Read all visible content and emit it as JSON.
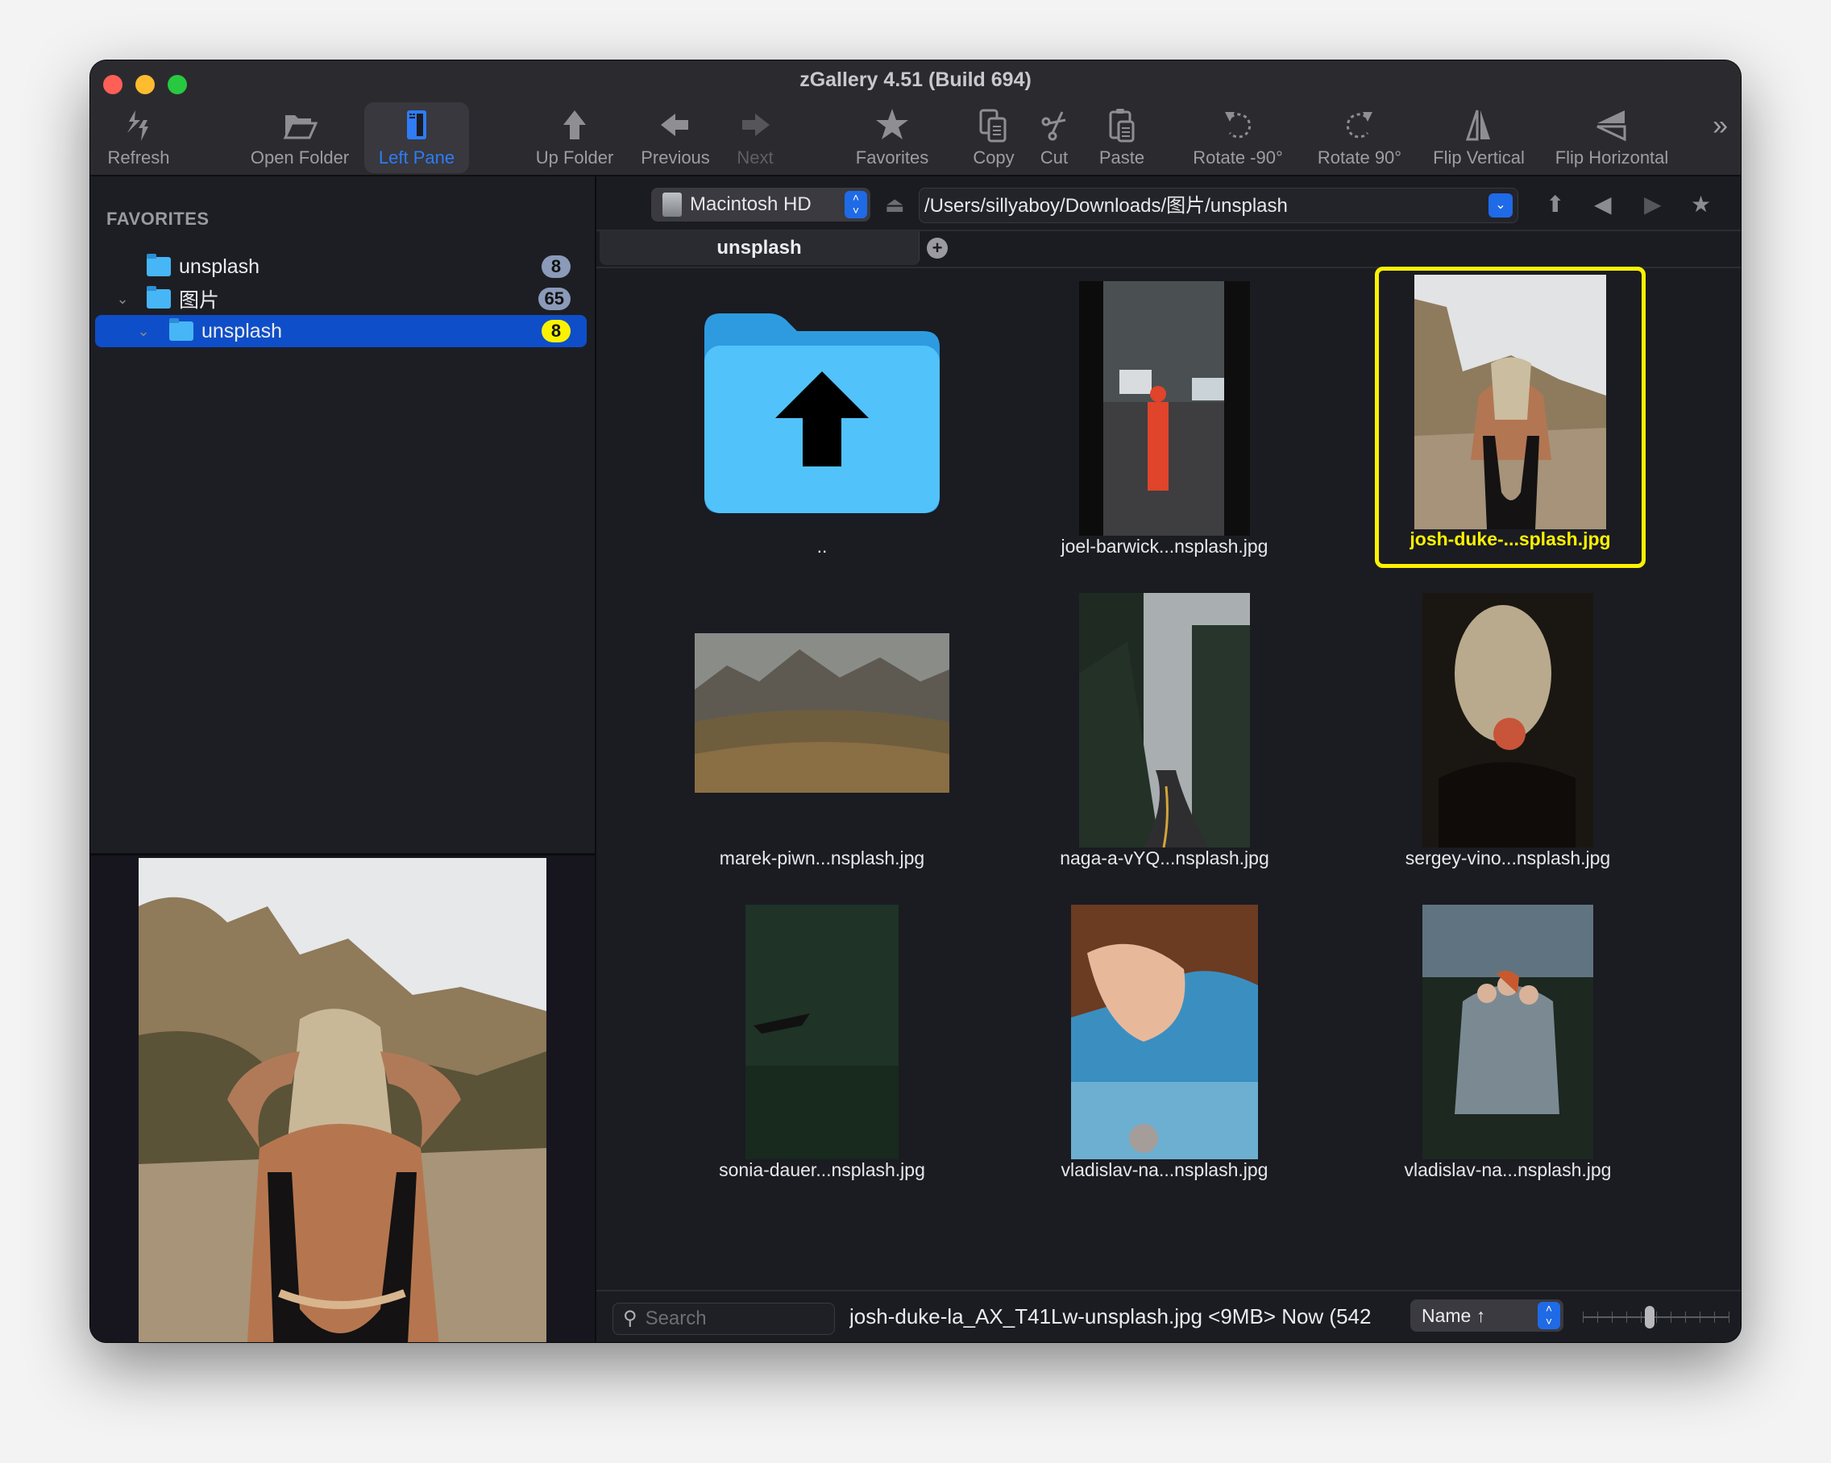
{
  "window": {
    "title": "zGallery 4.51 (Build 694)"
  },
  "toolbar": {
    "items": [
      {
        "id": "refresh",
        "label": "Refresh",
        "icon": "refresh-icon",
        "state": "normal"
      },
      {
        "id": "open-folder",
        "label": "Open Folder",
        "icon": "folder-open-icon",
        "state": "normal"
      },
      {
        "id": "left-pane",
        "label": "Left Pane",
        "icon": "sidebar-icon",
        "state": "active"
      },
      {
        "id": "up-folder",
        "label": "Up Folder",
        "icon": "arrow-up-icon",
        "state": "normal"
      },
      {
        "id": "previous",
        "label": "Previous",
        "icon": "arrow-left-icon",
        "state": "normal"
      },
      {
        "id": "next",
        "label": "Next",
        "icon": "arrow-right-icon",
        "state": "disabled"
      },
      {
        "id": "favorites",
        "label": "Favorites",
        "icon": "star-icon",
        "state": "normal"
      },
      {
        "id": "copy",
        "label": "Copy",
        "icon": "copy-icon",
        "state": "normal"
      },
      {
        "id": "cut",
        "label": "Cut",
        "icon": "scissors-icon",
        "state": "normal"
      },
      {
        "id": "paste",
        "label": "Paste",
        "icon": "paste-icon",
        "state": "normal"
      },
      {
        "id": "rotate-ccw",
        "label": "Rotate -90°",
        "icon": "rotate-ccw-icon",
        "state": "normal"
      },
      {
        "id": "rotate-cw",
        "label": "Rotate 90°",
        "icon": "rotate-cw-icon",
        "state": "normal"
      },
      {
        "id": "flip-vertical",
        "label": "Flip Vertical",
        "icon": "flip-vertical-icon",
        "state": "normal"
      },
      {
        "id": "flip-horizontal",
        "label": "Flip Horizontal",
        "icon": "flip-horizontal-icon",
        "state": "normal"
      }
    ],
    "overflow_glyph": "»"
  },
  "sidebar": {
    "heading": "FAVORITES",
    "items": [
      {
        "label": "unsplash",
        "count": "8",
        "level": 0,
        "expanded": null,
        "selected": false
      },
      {
        "label": "图片",
        "count": "65",
        "level": 0,
        "expanded": true,
        "selected": false
      },
      {
        "label": "unsplash",
        "count": "8",
        "level": 1,
        "expanded": true,
        "selected": true
      }
    ]
  },
  "pathbar": {
    "volume": "Macintosh HD",
    "path": "/Users/sillyaboy/Downloads/图片/unsplash"
  },
  "tabs": [
    {
      "label": "unsplash",
      "active": true
    }
  ],
  "grid": {
    "items": [
      {
        "caption": "..",
        "kind": "parent-folder",
        "selected": false
      },
      {
        "caption": "joel-barwick...nsplash.jpg",
        "kind": "image",
        "selected": false
      },
      {
        "caption": "josh-duke-...splash.jpg",
        "kind": "image",
        "selected": true
      },
      {
        "caption": "marek-piwn...nsplash.jpg",
        "kind": "image",
        "selected": false
      },
      {
        "caption": "naga-a-vYQ...nsplash.jpg",
        "kind": "image",
        "selected": false
      },
      {
        "caption": "sergey-vino...nsplash.jpg",
        "kind": "image",
        "selected": false
      },
      {
        "caption": "sonia-dauer...nsplash.jpg",
        "kind": "image",
        "selected": false
      },
      {
        "caption": "vladislav-na...nsplash.jpg",
        "kind": "image",
        "selected": false
      },
      {
        "caption": "vladislav-na...nsplash.jpg",
        "kind": "image",
        "selected": false
      }
    ]
  },
  "statusbar": {
    "search_placeholder": "Search",
    "status_text": "josh-duke-la_AX_T41Lw-unsplash.jpg <9MB> Now (542",
    "sort_label": "Name ↑",
    "zoom_level_fraction": 0.45
  },
  "colors": {
    "accent_blue": "#1f6ae6",
    "selection_blue": "#0f4ec9",
    "selection_yellow": "#fbf200",
    "folder_blue": "#46b6f6"
  }
}
